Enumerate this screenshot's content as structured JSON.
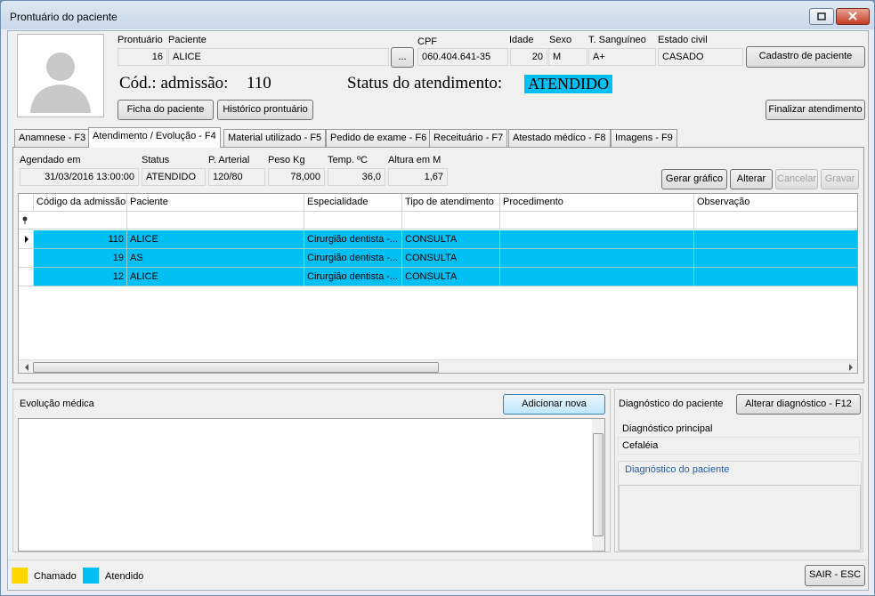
{
  "window": {
    "title": "Prontuário do paciente"
  },
  "patient": {
    "labels": {
      "prontuario": "Prontuário",
      "paciente": "Paciente",
      "cpf": "CPF",
      "idade": "Idade",
      "sexo": "Sexo",
      "sangue": "T. Sanguíneo",
      "estado_civil": "Estado civil"
    },
    "prontuario": "16",
    "paciente": "ALICE",
    "cpf": "060.404.641-35",
    "idade": "20",
    "sexo": "M",
    "sangue": "A+",
    "estado_civil": "CASADO",
    "browse_label": "...",
    "cadastro_label": "Cadastro de paciente",
    "cod_admissao_label": "Cód.: admissão:",
    "cod_admissao": "110",
    "status_label": "Status do atendimento:",
    "status": "ATENDIDO",
    "ficha_label": "Ficha do paciente",
    "historico_label": "Histórico prontuário",
    "finalizar_label": "Finalizar atendimento"
  },
  "tabs": [
    "Anamnese - F3",
    "Atendimento / Evolução - F4",
    "Material utilizado - F5",
    "Pedido de exame - F6",
    "Receituário - F7",
    "Atestado médico - F8",
    "Imagens - F9"
  ],
  "atendimento": {
    "labels": {
      "agendado": "Agendado em",
      "status": "Status",
      "pa": "P. Arterial",
      "peso": "Peso Kg",
      "temp": "Temp. ºC",
      "altura": "Altura em M"
    },
    "agendado": "31/03/2016 13:00:00",
    "status": "ATENDIDO",
    "pa": "120/80",
    "peso": "78,000",
    "temp": "36,0",
    "altura": "1,67",
    "buttons": {
      "grafico": "Gerar gráfico",
      "alterar": "Alterar",
      "cancelar": "Cancelar",
      "gravar": "Gravar"
    }
  },
  "grid": {
    "columns": [
      "Código da admissão",
      "Paciente",
      "Especialidade",
      "Tipo de atendimento",
      "Procedimento",
      "Observação"
    ],
    "filter_icon": "pin-icon",
    "rows": [
      {
        "codigo": "110",
        "paciente": "ALICE",
        "especialidade": "Cirurgião dentista -...",
        "tipo": "CONSULTA",
        "procedimento": "",
        "observacao": ""
      },
      {
        "codigo": "19",
        "paciente": "AS",
        "especialidade": "Cirurgião dentista -...",
        "tipo": "CONSULTA",
        "procedimento": "",
        "observacao": ""
      },
      {
        "codigo": "12",
        "paciente": "ALICE",
        "especialidade": "Cirurgião dentista -...",
        "tipo": "CONSULTA",
        "procedimento": "",
        "observacao": ""
      }
    ]
  },
  "evolucao": {
    "title": "Evolução médica",
    "add_label": "Adicionar nova",
    "text": ""
  },
  "diagnostico": {
    "title": "Diagnóstico do paciente",
    "alterar_label": "Alterar diagnóstico - F12",
    "principal_label": "Diagnóstico principal",
    "principal": "Cefaléia",
    "paciente_label": "Diagnóstico do paciente"
  },
  "legend": {
    "chamado": "Chamado",
    "atendido": "Atendido",
    "chamado_color": "#ffd700",
    "atendido_color": "#00bff3"
  },
  "footer": {
    "sair_label": "SAIR - ESC"
  }
}
